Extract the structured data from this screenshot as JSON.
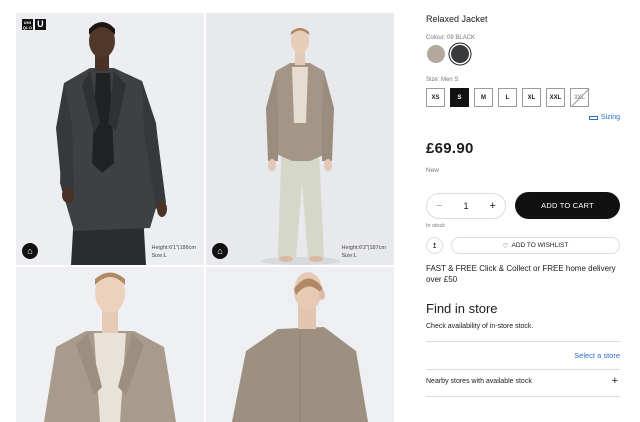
{
  "gallery": {
    "brand": {
      "top_text": "UNI QLO",
      "u_text": "U"
    },
    "tiles": [
      {
        "model_info_height": "Height:6'1\"|186cm",
        "model_info_size": "Size:L"
      },
      {
        "model_info_height": "Height:6'2\"|187cm",
        "model_info_size": "Size:L"
      }
    ]
  },
  "product": {
    "title": "Relaxed Jacket",
    "colour_label": "Colour: 09 BLACK",
    "colours": [
      {
        "name": "beige",
        "color": "#b4a89d"
      },
      {
        "name": "black",
        "color": "#383b3d"
      }
    ],
    "size_label": "Size: Men S",
    "sizes": [
      "XS",
      "S",
      "M",
      "L",
      "XL",
      "XXL",
      "3XL"
    ],
    "selected_size": "S",
    "unavailable_sizes": [
      "3XL"
    ],
    "sizing_link": "Sizing",
    "price": "£69.90",
    "badge": "New",
    "quantity": "1",
    "quantity_minus": "−",
    "quantity_plus": "+",
    "add_to_cart": "ADD TO CART",
    "stock_status": "In stock",
    "share_icon": "↥",
    "wishlist_icon": "♡",
    "wishlist": "ADD TO WISHLIST",
    "delivery": "FAST & FREE Click & Collect or FREE home delivery over £50"
  },
  "find_in_store": {
    "title": "Find in store",
    "description": "Check availability of in-store stock.",
    "select_store": "Select a store",
    "nearby": "Nearby stores with available stock",
    "expand_icon": "+"
  },
  "colors": {
    "accent_link": "#2c6ecb",
    "primary_button": "#111111"
  }
}
